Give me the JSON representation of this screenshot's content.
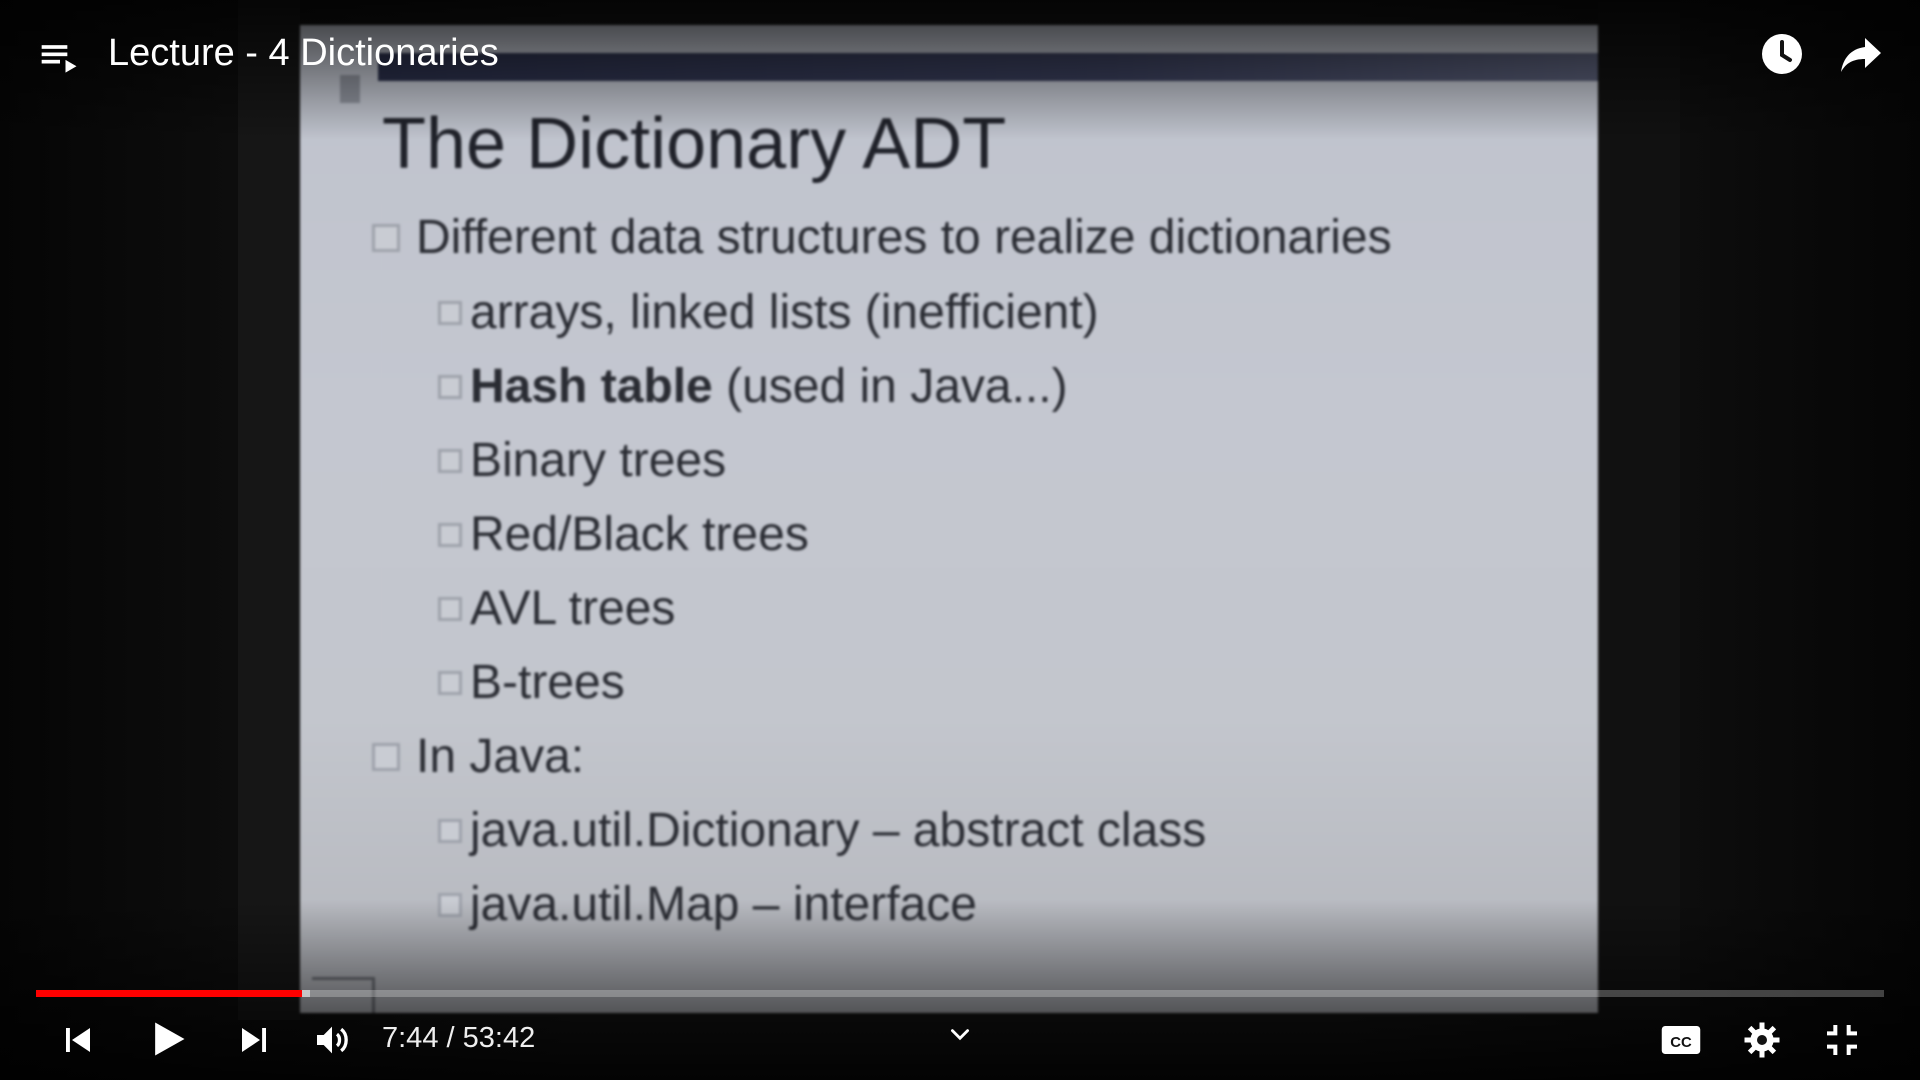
{
  "video": {
    "title": "Lecture - 4 Dictionaries",
    "current_time": "7:44",
    "duration": "53:42",
    "time_display": "7:44 / 53:42",
    "progress_fraction": 0.144,
    "buffered_fraction": 0.148
  },
  "slide": {
    "title": "The Dictionary ADT",
    "bullets": [
      {
        "level": 1,
        "text": "Different data structures to realize dictionaries"
      },
      {
        "level": 2,
        "text": "arrays, linked lists (inefficient)"
      },
      {
        "level": 2,
        "bold": "Hash table",
        "text": " (used in Java...)"
      },
      {
        "level": 2,
        "text": "Binary trees"
      },
      {
        "level": 2,
        "text": "Red/Black trees"
      },
      {
        "level": 2,
        "text": "AVL trees"
      },
      {
        "level": 2,
        "text": "B-trees"
      },
      {
        "level": 1,
        "text": "In Java:"
      },
      {
        "level": 2,
        "text": "java.util.Dictionary – abstract class"
      },
      {
        "level": 2,
        "text": "java.util.Map – interface"
      }
    ]
  },
  "icons": {
    "playlist": "playlist-icon",
    "watch_later": "clock-icon",
    "share": "share-icon",
    "previous": "skip-previous-icon",
    "play": "play-icon",
    "next": "skip-next-icon",
    "volume": "volume-icon",
    "chevron": "chevron-down-icon",
    "captions": "cc-icon",
    "settings": "gear-icon",
    "exit_fullscreen": "exit-fullscreen-icon"
  },
  "colors": {
    "progress_played": "#ff0000",
    "overlay_text": "#ffffff"
  }
}
